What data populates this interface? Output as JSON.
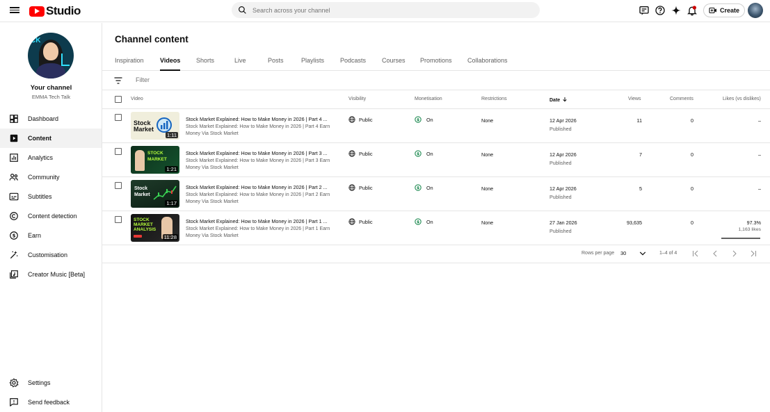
{
  "app": {
    "logo_text": "Studio"
  },
  "search": {
    "placeholder": "Search across your channel"
  },
  "header": {
    "create_label": "Create"
  },
  "channel": {
    "name": "Your channel",
    "handle": "EMMA Tech Talk",
    "avatar_text": "CK"
  },
  "sidebar": {
    "items": [
      {
        "label": "Dashboard",
        "icon": "dashboard-icon"
      },
      {
        "label": "Content",
        "icon": "content-icon"
      },
      {
        "label": "Analytics",
        "icon": "analytics-icon"
      },
      {
        "label": "Community",
        "icon": "community-icon"
      },
      {
        "label": "Subtitles",
        "icon": "subtitles-icon"
      },
      {
        "label": "Content detection",
        "icon": "copyright-icon"
      },
      {
        "label": "Earn",
        "icon": "dollar-icon"
      },
      {
        "label": "Customisation",
        "icon": "magic-wand-icon"
      },
      {
        "label": "Creator Music [Beta]",
        "icon": "music-icon"
      }
    ],
    "bottom": [
      {
        "label": "Settings",
        "icon": "gear-icon"
      },
      {
        "label": "Send feedback",
        "icon": "feedback-icon"
      }
    ]
  },
  "page": {
    "title": "Channel content"
  },
  "tabs": [
    {
      "label": "Inspiration"
    },
    {
      "label": "Videos"
    },
    {
      "label": "Shorts"
    },
    {
      "label": "Live"
    },
    {
      "label": "Posts"
    },
    {
      "label": "Playlists"
    },
    {
      "label": "Podcasts"
    },
    {
      "label": "Courses"
    },
    {
      "label": "Promotions"
    },
    {
      "label": "Collaborations"
    }
  ],
  "filter": {
    "placeholder": "Filter"
  },
  "table": {
    "headers": {
      "video": "Video",
      "visibility": "Visibility",
      "monetisation": "Monetisation",
      "restrictions": "Restrictions",
      "date": "Date",
      "views": "Views",
      "comments": "Comments",
      "likes": "Likes (vs dislikes)"
    },
    "rows": [
      {
        "title": "Stock Market Explained: How to Make Money in 2026 | Part 4 ...",
        "description": "Stock Market Explained: How to Make Money in 2026 | Part 4 Earn Money Via Stock Market",
        "duration": "1:11",
        "thumb_text": "Stock Market",
        "visibility": "Public",
        "monetisation": "On",
        "restrictions": "None",
        "date": "12 Apr 2026",
        "date_status": "Published",
        "views": "11",
        "comments": "0",
        "likes": "–",
        "likes_sub": ""
      },
      {
        "title": "Stock Market Explained: How to Make Money in 2026 | Part 3 ...",
        "description": "Stock Market Explained: How to Make Money in 2026 | Part 3 Earn Money Via Stock Market",
        "duration": "1:21",
        "thumb_text": "STOCK MARKET",
        "visibility": "Public",
        "monetisation": "On",
        "restrictions": "None",
        "date": "12 Apr 2026",
        "date_status": "Published",
        "views": "7",
        "comments": "0",
        "likes": "–",
        "likes_sub": ""
      },
      {
        "title": "Stock Market Explained: How to Make Money in 2026 | Part 2 ...",
        "description": "Stock Market Explained: How to Make Money in 2026 | Part 2 Earn Money Via Stock Market",
        "duration": "1:17",
        "thumb_text": "Stock Market",
        "visibility": "Public",
        "monetisation": "On",
        "restrictions": "None",
        "date": "12 Apr 2026",
        "date_status": "Published",
        "views": "5",
        "comments": "0",
        "likes": "–",
        "likes_sub": ""
      },
      {
        "title": "Stock Market Explained: How to Make Money in 2026 | Part 1 ...",
        "description": "Stock Market Explained: How to Make Money in 2026 | Part 1 Earn Money Via Stock Market",
        "duration": "11:28",
        "thumb_text": "STOCK MARKET ANALYSIS",
        "visibility": "Public",
        "monetisation": "On",
        "restrictions": "None",
        "date": "27 Jan 2026",
        "date_status": "Published",
        "views": "93,635",
        "comments": "0",
        "likes": "97.3%",
        "likes_sub": "1,163 likes"
      }
    ]
  },
  "pagination": {
    "rows_per_page_label": "Rows per page",
    "rows_per_page": "30",
    "range": "1–4 of 4"
  },
  "colors": {
    "accent": "#ff0000",
    "monetisation_on": "#0b8043"
  }
}
